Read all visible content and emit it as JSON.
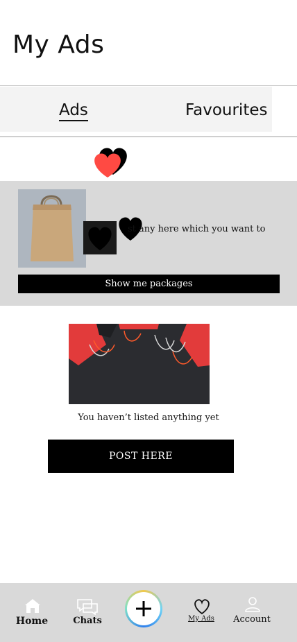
{
  "header": {
    "title": "My Ads"
  },
  "tabs": [
    {
      "label": "Ads",
      "active": true
    },
    {
      "label": "Favourites",
      "active": false
    }
  ],
  "promo": {
    "text": "st any here which you want to",
    "button_label": "Show me packages"
  },
  "empty_state": {
    "message": "You haven’t listed anything yet",
    "button_label": "POST HERE"
  },
  "bottom_nav": {
    "items": [
      {
        "label": "Home",
        "icon": "home-icon"
      },
      {
        "label": "Chats",
        "icon": "chat-icon"
      },
      {
        "label": "",
        "icon": "plus-icon"
      },
      {
        "label": "My Ads",
        "icon": "heart-outline-icon",
        "active": true
      },
      {
        "label": "Account",
        "icon": "person-icon"
      }
    ]
  },
  "colors": {
    "heart_red": "#ff4a43",
    "black": "#000000",
    "panel_gray": "#d9d9d9",
    "tab_bg": "#f3f3f3"
  }
}
